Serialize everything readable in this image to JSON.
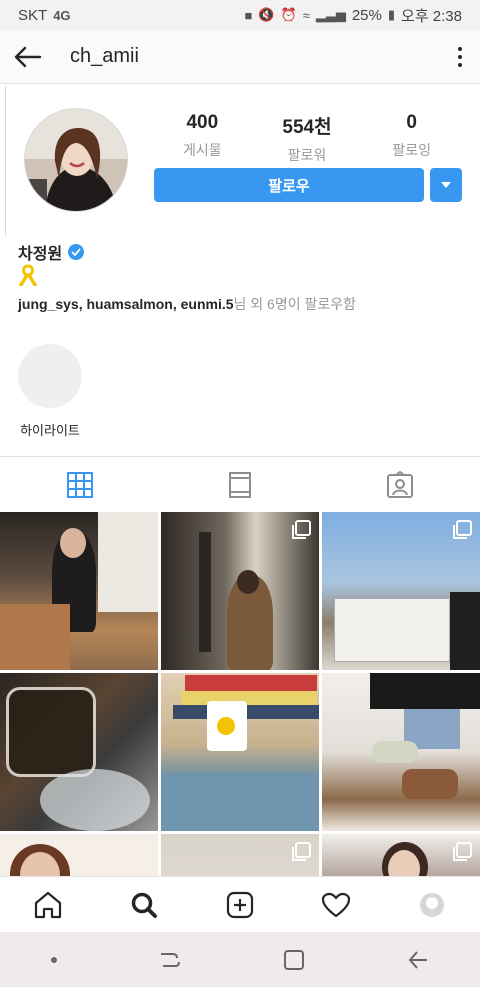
{
  "status_bar": {
    "carrier": "SKT",
    "network": "4G",
    "battery": "25%",
    "time": "오후 2:38"
  },
  "header": {
    "username": "ch_amii"
  },
  "profile": {
    "stats": [
      {
        "count": "400",
        "label": "게시물"
      },
      {
        "count": "554천",
        "label": "팔로워"
      },
      {
        "count": "0",
        "label": "팔로잉"
      }
    ],
    "follow_label": "팔로우",
    "full_name": "차정원",
    "bio_emoji": "🎗",
    "followed_by": {
      "names": "jung_sys, huamsalmon, eunmi.5",
      "suffix": "님 외 6명이 팔로우함"
    },
    "highlight_label": "하이라이트"
  },
  "tabs": [
    "grid-icon",
    "feed-icon",
    "tagged-icon"
  ],
  "colors": {
    "accent": "#3897f0",
    "muted": "#999999"
  }
}
